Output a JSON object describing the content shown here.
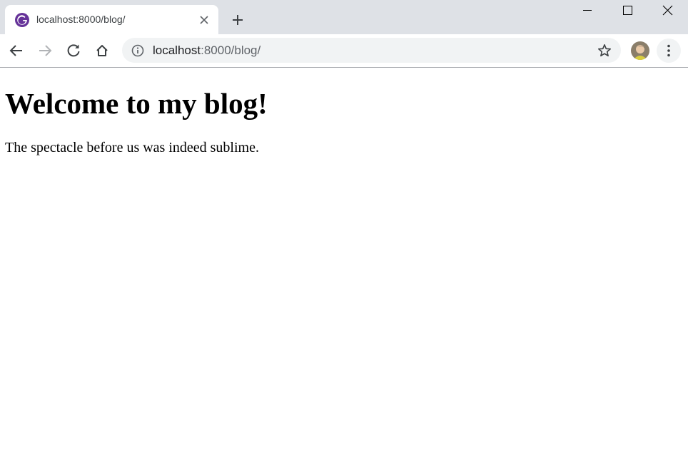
{
  "browser": {
    "tab": {
      "title": "localhost:8000/blog/",
      "favicon": "gatsby-logo-icon"
    },
    "toolbar": {
      "url_host": "localhost",
      "url_rest": ":8000/blog/"
    },
    "icons": {
      "new_tab": "plus-icon",
      "minimize": "minimize-icon",
      "maximize": "maximize-icon",
      "close": "close-icon",
      "back": "arrow-left-icon",
      "forward": "arrow-right-icon",
      "reload": "reload-icon",
      "home": "home-icon",
      "site_info": "info-icon",
      "bookmark": "star-icon",
      "menu": "kebab-menu-icon"
    },
    "colors": {
      "tabstrip": "#dee1e6",
      "omnibox": "#f1f3f4",
      "favicon": "#663399"
    }
  },
  "page": {
    "heading": "Welcome to my blog!",
    "paragraph": "The spectacle before us was indeed sublime."
  }
}
